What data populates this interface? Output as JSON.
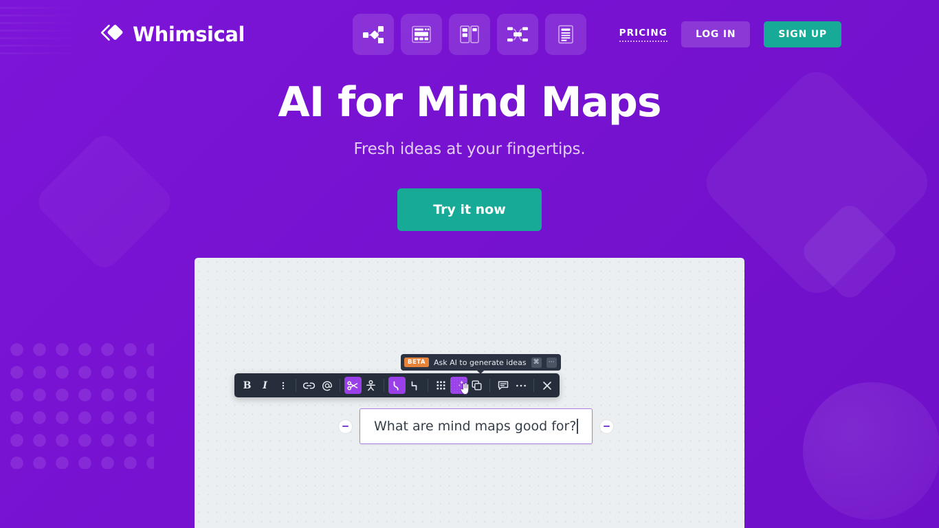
{
  "brand": {
    "name": "Whimsical",
    "logo_icon": "whimsical-diamond-logo",
    "accent_purple": "#7916d4",
    "accent_teal": "#17aa97",
    "toolbar_dark": "#262e3c",
    "highlight_purple": "#9a40e8",
    "beta_orange": "#e8833a"
  },
  "header": {
    "nav_icons": [
      {
        "name": "flowcharts-icon",
        "label": "Flowcharts"
      },
      {
        "name": "wireframes-icon",
        "label": "Wireframes"
      },
      {
        "name": "sticky-notes-icon",
        "label": "Sticky Notes"
      },
      {
        "name": "mind-maps-icon",
        "label": "Mind Maps"
      },
      {
        "name": "docs-icon",
        "label": "Docs"
      }
    ],
    "pricing_label": "PRICING",
    "login_label": "LOG IN",
    "signup_label": "SIGN UP"
  },
  "hero": {
    "title": "AI for Mind Maps",
    "subtitle": "Fresh ideas at your fingertips.",
    "cta_label": "Try it now"
  },
  "canvas": {
    "tooltip": {
      "badge": "BETA",
      "text": "Ask AI to generate ideas",
      "shortcut_keys": [
        "⌘",
        "⋯"
      ]
    },
    "toolbar": {
      "buttons": [
        {
          "name": "bold-button",
          "glyph": "B",
          "kind": "text",
          "active": false
        },
        {
          "name": "italic-button",
          "glyph": "I",
          "kind": "text-italic",
          "active": false
        },
        {
          "name": "more-text-options-button",
          "glyph": "vertical-dots-icon",
          "kind": "icon",
          "active": false
        },
        {
          "name": "link-button",
          "glyph": "link-icon",
          "kind": "icon",
          "active": false
        },
        {
          "name": "mention-button",
          "glyph": "at-icon",
          "kind": "icon",
          "active": false
        },
        {
          "name": "shuffle-layout-button",
          "glyph": "scissors-icon",
          "kind": "icon",
          "active": true
        },
        {
          "name": "person-button",
          "glyph": "person-icon",
          "kind": "icon",
          "active": false
        },
        {
          "name": "curved-connector-button",
          "glyph": "curved-line-icon",
          "kind": "icon",
          "active": true
        },
        {
          "name": "elbow-connector-button",
          "glyph": "elbow-line-icon",
          "kind": "icon",
          "active": false
        },
        {
          "name": "grid-layout-button",
          "glyph": "grid-dots-icon",
          "kind": "icon",
          "active": false
        },
        {
          "name": "ask-ai-button",
          "glyph": "ai-sparkle-icon",
          "kind": "icon",
          "active": true
        },
        {
          "name": "duplicate-button",
          "glyph": "copy-icon",
          "kind": "icon",
          "active": false
        },
        {
          "name": "comment-button",
          "glyph": "comment-icon",
          "kind": "icon",
          "active": false
        },
        {
          "name": "more-options-button",
          "glyph": "ellipsis-icon",
          "kind": "icon",
          "active": false
        },
        {
          "name": "close-button",
          "glyph": "close-icon",
          "kind": "icon",
          "active": false
        }
      ]
    },
    "node": {
      "text": "What are mind maps good for?",
      "left_handle": "collapse-left-handle",
      "right_handle": "collapse-right-handle"
    }
  }
}
